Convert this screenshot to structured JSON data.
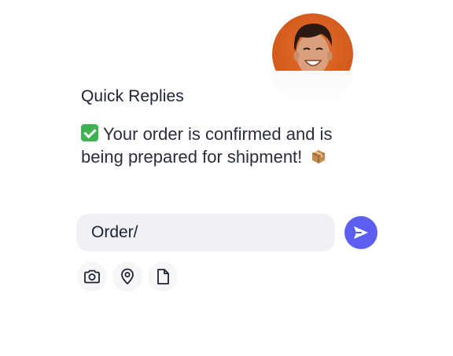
{
  "card": {
    "title": "Quick Replies",
    "message": {
      "prefix_emoji": "check-mark-icon",
      "text": "Your order is confirmed and is being prepared for shipment!",
      "suffix_emoji": "package-icon"
    }
  },
  "composer": {
    "input_value": "Order/",
    "send_icon": "send-icon",
    "send_color": "#5b5ef0",
    "attachments": [
      "camera-icon",
      "location-pin-icon",
      "document-icon"
    ]
  }
}
